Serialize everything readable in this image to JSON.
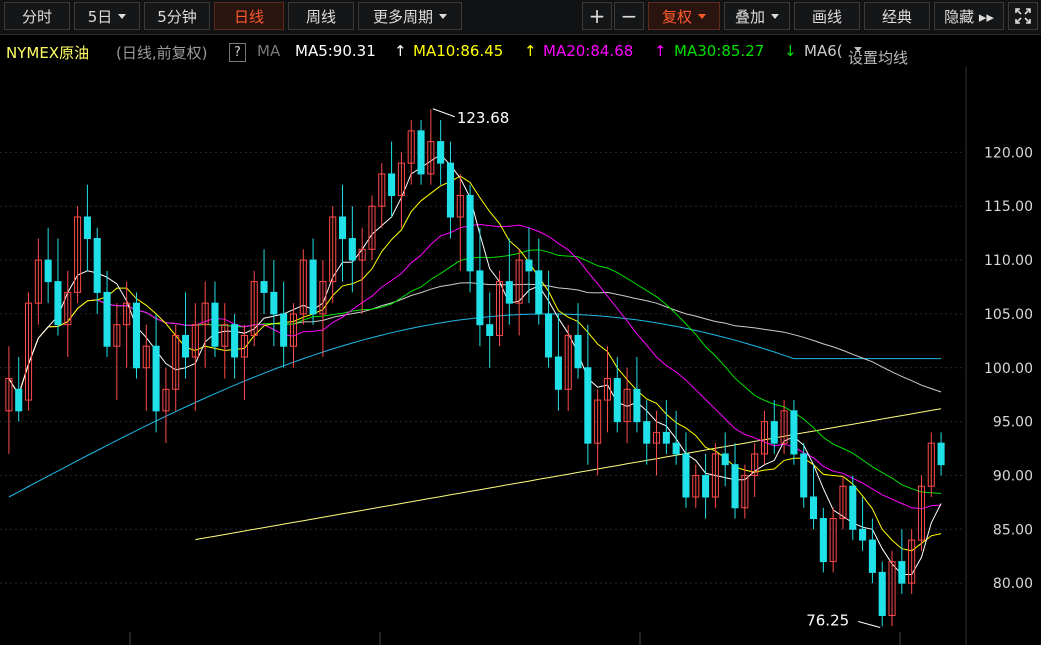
{
  "toolbar": {
    "tabs": [
      {
        "label": "分时",
        "active": false,
        "dropdown": false
      },
      {
        "label": "5日",
        "active": false,
        "dropdown": true
      },
      {
        "label": "5分钟",
        "active": false,
        "dropdown": false
      },
      {
        "label": "日线",
        "active": true,
        "dropdown": false
      },
      {
        "label": "周线",
        "active": false,
        "dropdown": false
      },
      {
        "label": "更多周期",
        "active": false,
        "dropdown": true
      }
    ],
    "zoom_in": "+",
    "zoom_out": "−",
    "right_buttons": [
      {
        "label": "复权",
        "active": true,
        "dropdown": true
      },
      {
        "label": "叠加",
        "active": false,
        "dropdown": true
      },
      {
        "label": "画线",
        "active": false,
        "dropdown": false
      },
      {
        "label": "经典",
        "active": false,
        "dropdown": false
      },
      {
        "label": "隐藏 ▸▸",
        "active": false,
        "dropdown": false
      }
    ],
    "fullscreen_icon": "expand-icon"
  },
  "infobar": {
    "symbol": "NYMEX原油",
    "mode": "(日线,前复权)",
    "help": "?",
    "ma_label": "MA",
    "ma5": "MA5:90.31",
    "ma10": "MA10:86.45",
    "ma20": "MA20:84.68",
    "ma30": "MA30:85.27",
    "ma60": "MA6(",
    "ma_settings": "设置均线",
    "arrow_up": "↑",
    "arrow_down": "↓",
    "colors": {
      "ma5": "#ffffff",
      "ma10": "#ffff00",
      "ma20": "#ff00ff",
      "ma30": "#00e000",
      "ma60": "#cccccc"
    }
  },
  "chart_data": {
    "type": "candlestick",
    "ylim": [
      75,
      127
    ],
    "y_ticks": [
      "120.00",
      "115.00",
      "110.00",
      "105.00",
      "100.00",
      "95.00",
      "90.00",
      "85.00",
      "80.00"
    ],
    "y_tick_values": [
      120,
      115,
      110,
      105,
      100,
      95,
      90,
      85,
      80
    ],
    "annotations": {
      "high": "123.68",
      "low": "76.25"
    },
    "high_value": 123.68,
    "low_value": 76.25,
    "colors": {
      "up": "#ff4a4a",
      "down": "#20e0e8",
      "ma5": "#ffffff",
      "ma10": "#ffff00",
      "ma20": "#ff00ff",
      "ma30": "#00e000",
      "ma60": "#cccccc",
      "ma120": "#20b8e8",
      "ma250": "#ffff80"
    },
    "candles": [
      [
        96,
        102,
        92,
        99
      ],
      [
        98,
        101,
        95,
        96
      ],
      [
        97,
        107,
        96,
        106
      ],
      [
        106,
        112,
        104,
        110
      ],
      [
        110,
        113,
        106,
        108
      ],
      [
        108,
        112,
        103,
        104
      ],
      [
        104,
        109,
        101,
        107
      ],
      [
        107,
        115,
        106,
        114
      ],
      [
        114,
        117,
        109,
        112
      ],
      [
        112,
        113,
        105,
        107
      ],
      [
        107,
        109,
        101,
        102
      ],
      [
        102,
        106,
        97,
        104
      ],
      [
        104,
        108,
        100,
        106
      ],
      [
        106,
        107,
        99,
        100
      ],
      [
        100,
        104,
        96,
        102
      ],
      [
        102,
        105,
        94,
        96
      ],
      [
        96,
        100,
        93,
        98
      ],
      [
        98,
        104,
        96,
        103
      ],
      [
        103,
        107,
        99,
        101
      ],
      [
        101,
        106,
        96,
        104
      ],
      [
        104,
        108,
        100,
        106
      ],
      [
        106,
        108,
        101,
        102
      ],
      [
        102,
        106,
        99,
        104
      ],
      [
        104,
        105,
        99,
        101
      ],
      [
        101,
        104,
        97,
        103
      ],
      [
        103,
        109,
        102,
        108
      ],
      [
        108,
        111,
        105,
        107
      ],
      [
        107,
        110,
        102,
        105
      ],
      [
        105,
        108,
        100,
        102
      ],
      [
        102,
        106,
        100,
        105
      ],
      [
        105,
        111,
        104,
        110
      ],
      [
        110,
        112,
        104,
        105
      ],
      [
        105,
        110,
        101,
        108
      ],
      [
        108,
        115,
        106,
        114
      ],
      [
        114,
        117,
        108,
        112
      ],
      [
        112,
        115,
        107,
        110
      ],
      [
        110,
        113,
        105,
        111
      ],
      [
        111,
        116,
        110,
        115
      ],
      [
        115,
        119,
        113,
        118
      ],
      [
        118,
        121,
        114,
        116
      ],
      [
        116,
        120,
        113,
        119
      ],
      [
        119,
        123,
        117,
        122
      ],
      [
        122,
        123,
        117,
        118
      ],
      [
        118,
        124,
        117,
        121
      ],
      [
        121,
        123,
        117,
        119
      ],
      [
        119,
        121,
        112,
        114
      ],
      [
        114,
        118,
        109,
        116
      ],
      [
        116,
        117,
        107,
        109
      ],
      [
        109,
        113,
        102,
        104
      ],
      [
        104,
        107,
        100,
        103
      ],
      [
        103,
        109,
        102,
        108
      ],
      [
        108,
        112,
        104,
        106
      ],
      [
        106,
        111,
        103,
        110
      ],
      [
        110,
        113,
        106,
        109
      ],
      [
        109,
        112,
        104,
        105
      ],
      [
        105,
        109,
        100,
        101
      ],
      [
        101,
        105,
        96,
        98
      ],
      [
        98,
        104,
        96,
        103
      ],
      [
        103,
        106,
        99,
        100
      ],
      [
        100,
        104,
        91,
        93
      ],
      [
        93,
        98,
        90,
        97
      ],
      [
        97,
        102,
        94,
        99
      ],
      [
        99,
        101,
        94,
        95
      ],
      [
        95,
        100,
        93,
        98
      ],
      [
        98,
        101,
        94,
        95
      ],
      [
        95,
        97,
        91,
        93
      ],
      [
        93,
        96,
        90,
        94
      ],
      [
        94,
        97,
        92,
        93
      ],
      [
        93,
        96,
        91,
        92
      ],
      [
        92,
        94,
        87,
        88
      ],
      [
        88,
        91,
        87,
        90
      ],
      [
        90,
        92,
        86,
        88
      ],
      [
        88,
        93,
        87,
        92
      ],
      [
        92,
        94,
        89,
        91
      ],
      [
        91,
        93,
        86,
        87
      ],
      [
        87,
        91,
        86,
        90
      ],
      [
        90,
        93,
        88,
        92
      ],
      [
        92,
        96,
        91,
        95
      ],
      [
        95,
        97,
        92,
        93
      ],
      [
        93,
        97,
        92,
        96
      ],
      [
        96,
        97,
        91,
        92
      ],
      [
        92,
        93,
        87,
        88
      ],
      [
        88,
        91,
        85,
        86
      ],
      [
        86,
        87,
        81,
        82
      ],
      [
        82,
        87,
        81,
        86
      ],
      [
        86,
        90,
        85,
        89
      ],
      [
        89,
        90,
        84,
        85
      ],
      [
        85,
        88,
        83,
        84
      ],
      [
        84,
        86,
        80,
        81
      ],
      [
        81,
        82,
        76,
        77
      ],
      [
        77,
        83,
        76,
        82
      ],
      [
        82,
        85,
        79,
        80
      ],
      [
        80,
        85,
        79,
        84
      ],
      [
        84,
        90,
        83,
        89
      ],
      [
        89,
        94,
        88,
        93
      ],
      [
        93,
        94,
        90,
        91
      ]
    ]
  }
}
